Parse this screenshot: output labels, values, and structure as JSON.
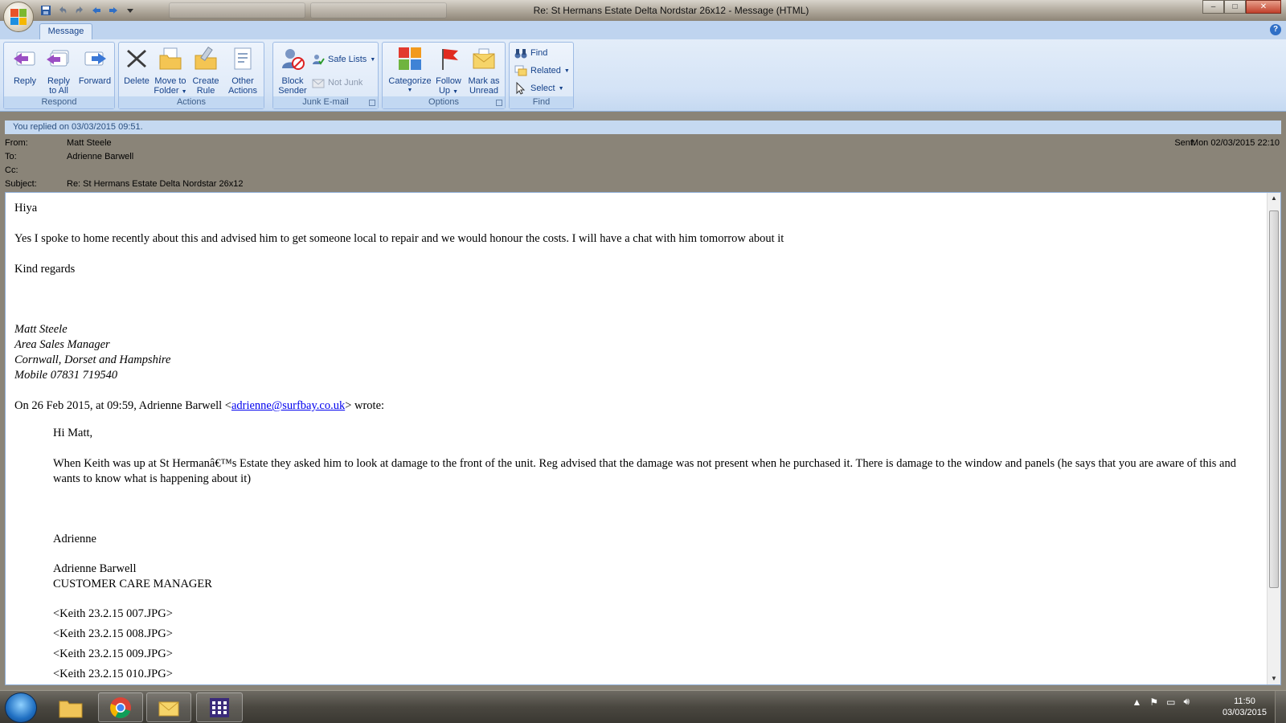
{
  "window": {
    "title": "Re: St Hermans Estate Delta Nordstar 26x12 - Message (HTML)",
    "controls": {
      "minimize": "–",
      "maximize": "□",
      "close": "✕"
    }
  },
  "ribbon": {
    "tab": "Message",
    "help": "?",
    "groups": {
      "respond": {
        "label": "Respond",
        "reply": "Reply",
        "reply_all_line1": "Reply",
        "reply_all_line2": "to All",
        "forward": "Forward"
      },
      "actions": {
        "label": "Actions",
        "delete": "Delete",
        "move_line1": "Move to",
        "move_line2": "Folder",
        "create_line1": "Create",
        "create_line2": "Rule",
        "other_line1": "Other",
        "other_line2": "Actions"
      },
      "junk": {
        "label": "Junk E-mail",
        "block_line1": "Block",
        "block_line2": "Sender",
        "safe_lists": "Safe Lists",
        "not_junk": "Not Junk"
      },
      "options": {
        "label": "Options",
        "categorize": "Categorize",
        "follow_line1": "Follow",
        "follow_line2": "Up",
        "mark_line1": "Mark as",
        "mark_line2": "Unread"
      },
      "find": {
        "label": "Find",
        "find": "Find",
        "related": "Related",
        "select": "Select"
      }
    }
  },
  "message": {
    "infobar": "You replied on 03/03/2015 09:51.",
    "from_label": "From:",
    "from": "Matt Steele",
    "to_label": "To:",
    "to": "Adrienne Barwell",
    "cc_label": "Cc:",
    "cc": "",
    "subject_label": "Subject:",
    "subject": "Re: St Hermans Estate Delta Nordstar 26x12",
    "sent_label": "Sent:",
    "sent": "Mon 02/03/2015 22:10"
  },
  "body": {
    "greeting": "Hiya",
    "para1": "Yes I spoke to home recently about this and advised him to get someone local to repair and we would honour the costs.  I will have a chat with him tomorrow about it",
    "closing": "Kind regards",
    "sig_name": "Matt Steele",
    "sig_title": "Area Sales Manager",
    "sig_region": "Cornwall, Dorset and Hampshire",
    "sig_mobile": "Mobile 07831 719540",
    "quote_intro_pre": "On 26 Feb 2015, at 09:59, Adrienne Barwell <",
    "quote_email": "adrienne@surfbay.co.uk",
    "quote_intro_post": "> wrote:",
    "q_greeting": "Hi Matt,",
    "q_para": "When Keith was up at St Hermanâ€™s Estate they asked him to look at damage to the front of the unit.  Reg advised that the damage was not present when he purchased it.  There is damage to the window and panels (he says that you are aware of this and wants to know what is happening about it)",
    "q_name": "Adrienne",
    "q_sig_name": "Adrienne Barwell",
    "q_sig_title": "CUSTOMER CARE MANAGER",
    "attachments": [
      "<Keith 23.2.15 007.JPG>",
      "<Keith 23.2.15 008.JPG>",
      "<Keith 23.2.15 009.JPG>",
      "<Keith 23.2.15 010.JPG>"
    ]
  },
  "taskbar": {
    "time": "11:50",
    "date": "03/03/2015"
  },
  "colors": {
    "ribbon_text": "#15428b",
    "infobar_bg": "#c5d9f1",
    "link": "#0000ee"
  }
}
